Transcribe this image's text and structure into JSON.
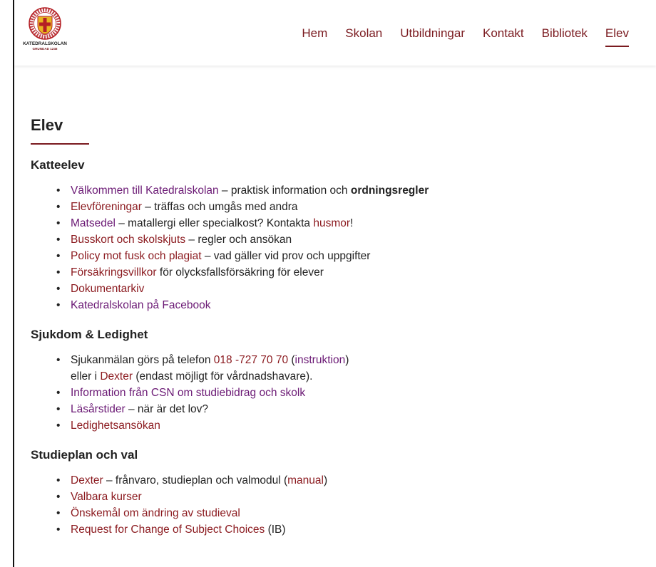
{
  "header": {
    "logo": {
      "name": "KATEDRALSKOLAN",
      "subtitle": "GRUNDAD 1246",
      "ring_text": "Cathedralschola Upsaliensis"
    },
    "nav": [
      {
        "label": "Hem"
      },
      {
        "label": "Skolan"
      },
      {
        "label": "Utbildningar"
      },
      {
        "label": "Kontakt"
      },
      {
        "label": "Bibliotek"
      },
      {
        "label": "Elev",
        "active": true
      }
    ]
  },
  "page": {
    "title": "Elev"
  },
  "sections": {
    "katteelev": {
      "title": "Katteelev",
      "items": {
        "valkommen": {
          "link": "Välkommen till Katedralskolan",
          "text": " – praktisk information och ",
          "bold": "ordningsregler"
        },
        "elevforeningar": {
          "link": "Elevföreningar",
          "text": " – träffas och umgås med andra"
        },
        "matsedel": {
          "link": "Matsedel",
          "text": " – matallergi eller specialkost? Kontakta ",
          "link2": "husmor",
          "text2": "!"
        },
        "busskort": {
          "link": "Busskort och skolskjuts",
          "text": " – regler och ansökan"
        },
        "policy": {
          "link": "Policy mot fusk och plagiat",
          "text": " – vad gäller vid prov och uppgifter"
        },
        "forsakring": {
          "link": "Försäkringsvillkor",
          "text": " för olycksfallsförsäkring för elever"
        },
        "dokumentarkiv": {
          "link": "Dokumentarkiv"
        },
        "facebook": {
          "link": "Katedralskolan på Facebook"
        }
      }
    },
    "sjukdom": {
      "title": "Sjukdom & Ledighet",
      "items": {
        "sjukanmalan": {
          "text": "Sjukanmälan görs på telefon ",
          "phone": "018 -727 70 70",
          "paren_open": " (",
          "instruktion": "instruktion",
          "paren_close": ")",
          "line2_text": "eller i ",
          "dexter": "Dexter",
          "line2_end": " (endast möjligt för vårdnadshavare)."
        },
        "csn": {
          "link": "Information från CSN om studiebidrag och skolk"
        },
        "lasarstider": {
          "link": "Läsårstider",
          "text": " – när är det lov?"
        },
        "ledighet": {
          "link": "Ledighetsansökan"
        }
      }
    },
    "studieplan": {
      "title": "Studieplan och val",
      "items": {
        "dexter": {
          "link": "Dexter",
          "text": " – frånvaro, studieplan och valmodul (",
          "link2": "manual",
          "text2": ")"
        },
        "valbara": {
          "link": "Valbara kurser"
        },
        "onskemal": {
          "link": "Önskemål om ändring av studieval"
        },
        "request": {
          "link": "Request for Change of Subject Choices",
          "text": " (IB)"
        }
      }
    }
  },
  "colors": {
    "brand": "#7a1a1f",
    "link": "#8b1a1f",
    "visited": "#6b1a75",
    "text": "#222222"
  }
}
